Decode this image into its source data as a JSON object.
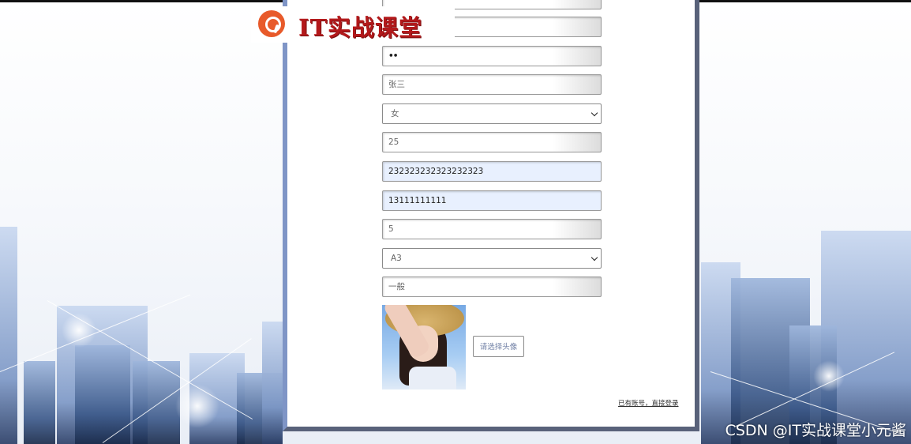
{
  "logo": {
    "text": "IT实战课堂"
  },
  "form": {
    "password_masked": "••",
    "name": "张三",
    "gender": "女",
    "age": "25",
    "id_number": "232323232323232323",
    "phone": "13111111111",
    "number_field": "5",
    "level_select": "A3",
    "category": "一般",
    "upload_button": "请选择头像",
    "login_link": "已有账号，直接登录"
  },
  "watermark": "CSDN @IT实战课堂小元酱",
  "colors": {
    "logo_red": "#b3191b",
    "logo_icon": "#e85a2a",
    "card_border_left": "#7f95c6",
    "card_border_right": "#59627a",
    "filled_bg": "#e8f0fe"
  }
}
